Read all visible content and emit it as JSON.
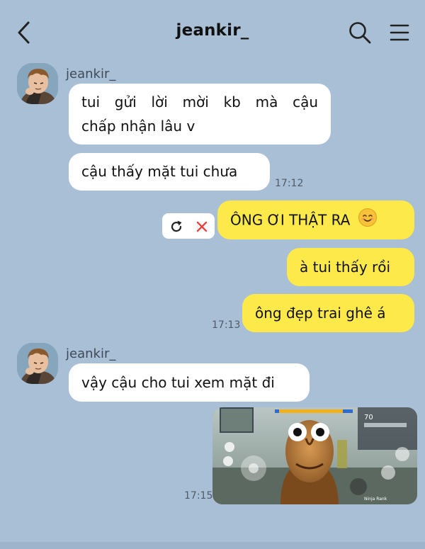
{
  "header": {
    "title": "jeankir_",
    "icons": {
      "back": "chevron-left-icon",
      "search": "search-icon",
      "menu": "hamburger-menu-icon"
    }
  },
  "messages": [
    {
      "from": "them",
      "sender": "jeankir_",
      "lines": [
        "tui gửi lời mời kb mà cậu",
        "chấp nhận lâu v"
      ]
    },
    {
      "from": "them",
      "text": "cậu thấy mặt tui chưa",
      "time": "17:12"
    },
    {
      "from": "me",
      "text": "ÔNG ƠI THẬT RA",
      "emoji": "😊",
      "status": "failed"
    },
    {
      "from": "me",
      "text": "à tui thấy rồi"
    },
    {
      "from": "me",
      "text": "ông đẹp trai ghê á",
      "time": "17:13"
    },
    {
      "from": "them",
      "sender": "jeankir_",
      "text": "vậy cậu cho tui xem mặt đi"
    },
    {
      "from": "me",
      "type": "image",
      "time": "17:15"
    }
  ],
  "photo": {
    "hud_ammo": "70",
    "hud_small": "Ninja Rank"
  },
  "colors": {
    "background": "#a9bfd6",
    "incoming_bubble": "#ffffff",
    "outgoing_bubble": "#fee94a",
    "cancel": "#e8453c"
  }
}
